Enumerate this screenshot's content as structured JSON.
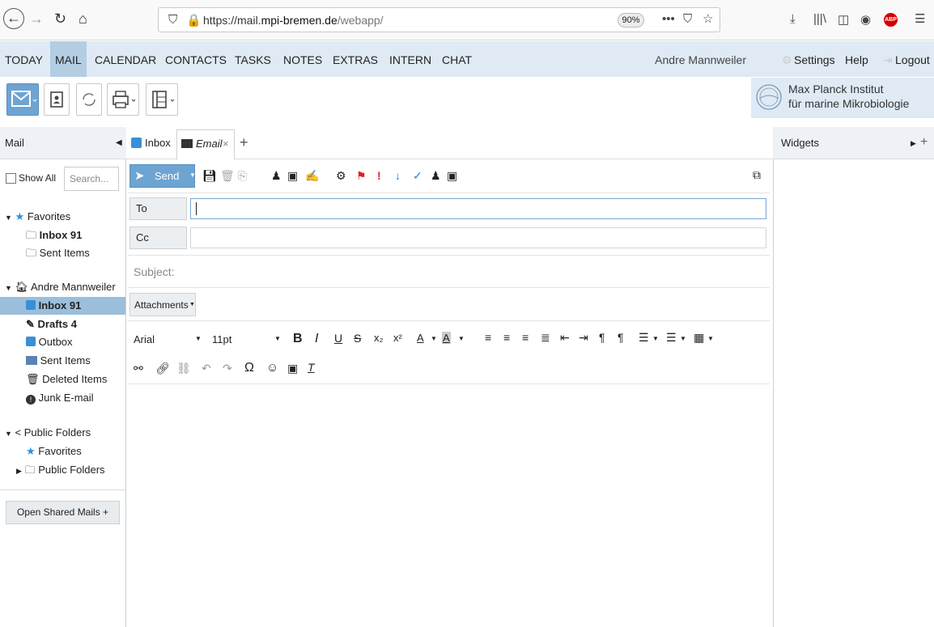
{
  "browser": {
    "url_scheme": "https://mail.",
    "url_host": "mpi-bremen.de",
    "url_path": "/webapp/",
    "zoom": "90%",
    "abp_label": "ABP"
  },
  "topnav": {
    "items": [
      "TODAY",
      "MAIL",
      "CALENDAR",
      "CONTACTS",
      "TASKS",
      "NOTES",
      "EXTRAS",
      "INTERN",
      "CHAT"
    ],
    "active": "MAIL",
    "user": "Andre Mannweiler",
    "settings": "Settings",
    "help": "Help",
    "logout": "Logout"
  },
  "logo": {
    "line1": "Max Planck Institut",
    "line2": "für marine Mikrobiologie"
  },
  "panels": {
    "mail": "Mail",
    "widgets": "Widgets"
  },
  "tabs": {
    "inbox": "Inbox",
    "email": "Email"
  },
  "sidebar": {
    "show_all": "Show All",
    "search_placeholder": "Search...",
    "favorites": "Favorites",
    "fav_inbox": "Inbox 91",
    "fav_sent": "Sent Items",
    "account": "Andre Mannweiler",
    "inbox": "Inbox 91",
    "drafts": "Drafts 4",
    "outbox": "Outbox",
    "sent": "Sent Items",
    "deleted": "Deleted Items",
    "junk": "Junk E-mail",
    "public": "Public Folders",
    "pub_favorites": "Favorites",
    "pub_folders": "Public Folders",
    "open_shared": "Open Shared Mails +"
  },
  "compose": {
    "send": "Send",
    "to": "To",
    "cc": "Cc",
    "subject_placeholder": "Subject:",
    "attachments": "Attachments",
    "font": "Arial",
    "size": "11pt"
  },
  "colors": {
    "nav_bg": "#dfeaf5",
    "active_bg": "#b3cde3",
    "send_bg": "#6ea4d1",
    "selected_bg": "#9bbedb",
    "favorite_star": "#2a8fe0",
    "flag_red": "#e02020"
  }
}
